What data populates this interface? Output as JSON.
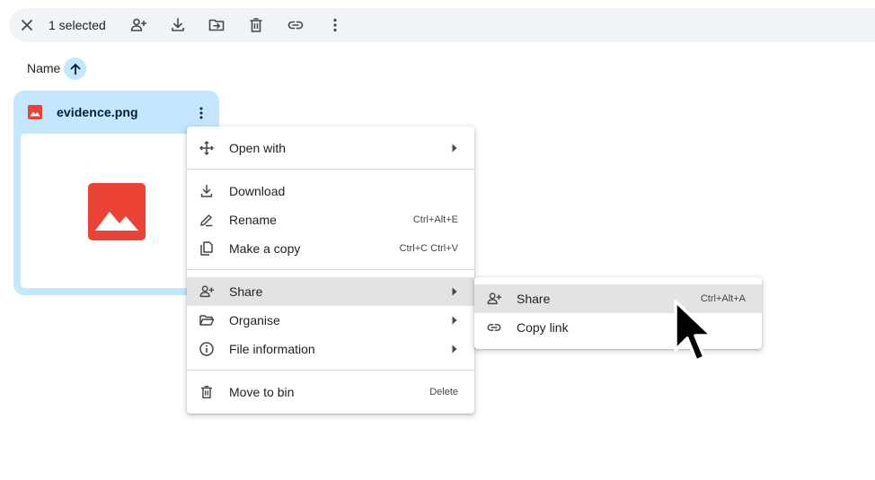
{
  "toolbar": {
    "selected_count": "1 selected",
    "actions": [
      "close-icon",
      "share-icon",
      "download-icon",
      "move-icon",
      "delete-icon",
      "link-icon",
      "more-vert-icon"
    ]
  },
  "sort": {
    "label": "Name",
    "direction_icon": "arrow-up-icon"
  },
  "file": {
    "name": "evidence.png",
    "type_icon": "image-icon",
    "accent": "#ea4335"
  },
  "context_menu": {
    "open_with": "Open with",
    "download": "Download",
    "rename": "Rename",
    "rename_shortcut": "Ctrl+Alt+E",
    "make_copy": "Make a copy",
    "make_copy_shortcut": "Ctrl+C Ctrl+V",
    "share": "Share",
    "organise": "Organise",
    "file_information": "File information",
    "move_to_bin": "Move to bin",
    "move_to_bin_shortcut": "Delete"
  },
  "share_submenu": {
    "share": "Share",
    "share_shortcut": "Ctrl+Alt+A",
    "copy_link": "Copy link"
  },
  "colors": {
    "toolbar_bg": "#f0f4f9",
    "selected_bg": "#c2e7ff",
    "highlight": "#e3e3e3"
  }
}
